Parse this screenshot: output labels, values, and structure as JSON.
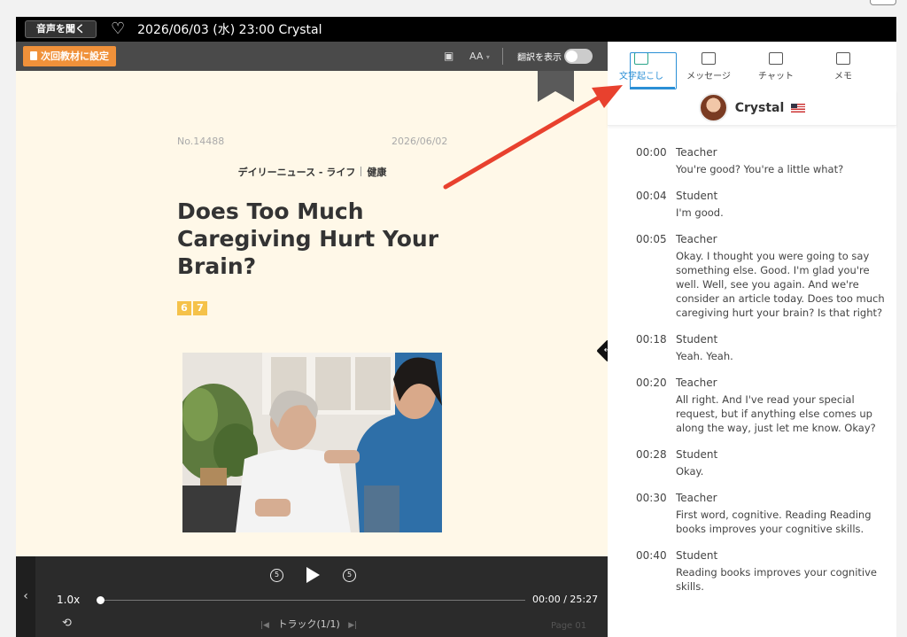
{
  "topbar": {
    "listen_label": "音声を聞く",
    "heart_icon": "heart-outline-icon",
    "session_title": "2026/06/03 (水) 23:00 Crystal"
  },
  "toolbar": {
    "next_material_label": "次回教材に設定",
    "font_size_label": "AA",
    "translate_label": "翻訳を表示"
  },
  "article": {
    "number": "No.14488",
    "date": "2026/06/02",
    "category": "デイリーニュース - ライフ",
    "subcategory": "健康",
    "title": "Does Too Much Caregiving Hurt Your Brain?",
    "levels": [
      "6",
      "7"
    ]
  },
  "player": {
    "speed": "1.0x",
    "time": "00:00 / 25:27",
    "track": "トラック(1/1)",
    "page": "Page 01",
    "skip_back_label": "5",
    "skip_forward_label": "5",
    "progress_fraction": 0
  },
  "tabs": [
    {
      "label": "文字起こし",
      "icon": "transcript-icon",
      "active": true
    },
    {
      "label": "メッセージ",
      "icon": "message-icon",
      "active": false
    },
    {
      "label": "チャット",
      "icon": "chat-icon",
      "active": false
    },
    {
      "label": "メモ",
      "icon": "memo-icon",
      "active": false
    }
  ],
  "teacher": {
    "name": "Crystal",
    "flag": "us-flag-icon"
  },
  "transcript": [
    {
      "time": "00:00",
      "speaker": "Teacher",
      "text": "You're good? You're a little what?"
    },
    {
      "time": "00:04",
      "speaker": "Student",
      "text": "I'm good."
    },
    {
      "time": "00:05",
      "speaker": "Teacher",
      "text": "Okay. I thought you were going to say something else. Good. I'm glad you're well. Well, see you again. And we're consider an article today. Does too much caregiving hurt your brain? Is that right?"
    },
    {
      "time": "00:18",
      "speaker": "Student",
      "text": "Yeah. Yeah."
    },
    {
      "time": "00:20",
      "speaker": "Teacher",
      "text": "All right. And I've read your special request, but if anything else comes up along the way, just let me know. Okay?"
    },
    {
      "time": "00:28",
      "speaker": "Student",
      "text": "Okay."
    },
    {
      "time": "00:30",
      "speaker": "Teacher",
      "text": "First word, cognitive. Reading Reading books improves your cognitive skills."
    },
    {
      "time": "00:40",
      "speaker": "Student",
      "text": "Reading books improves your cognitive skills."
    }
  ],
  "colors": {
    "accent_orange": "#f0913a",
    "article_bg": "#fff8e8",
    "active_tab": "#2a8fd6",
    "level_badge": "#f5c24a",
    "annotation_arrow": "#e8412e"
  }
}
